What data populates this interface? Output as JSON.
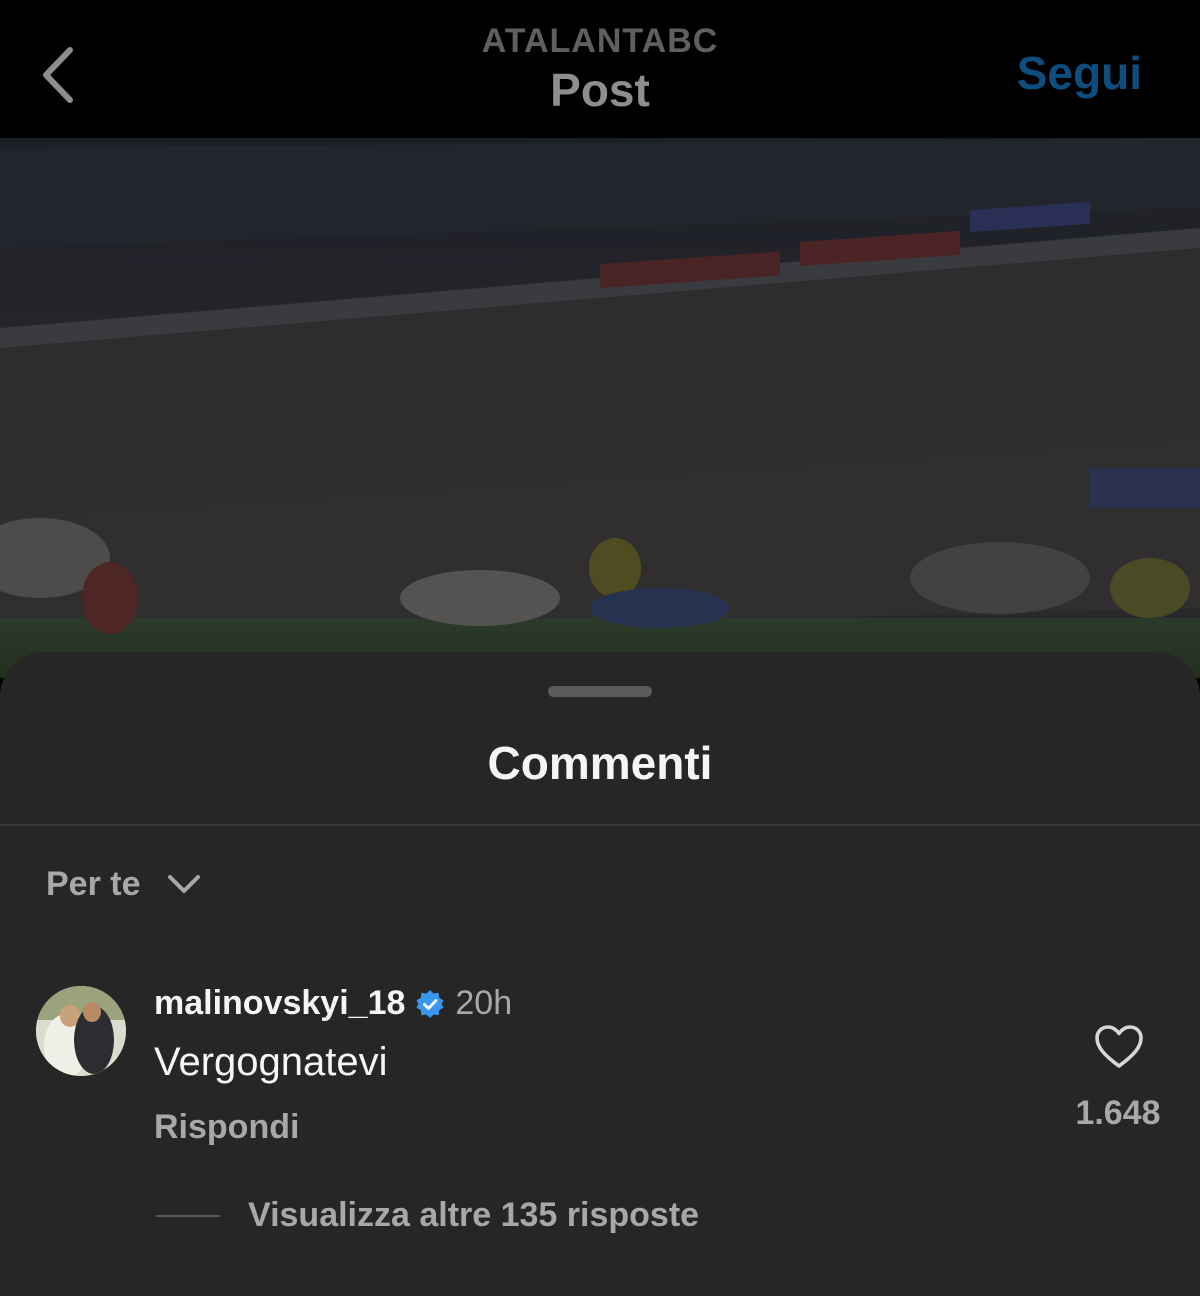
{
  "header": {
    "account": "ATALANTABC",
    "title": "Post",
    "follow_label": "Segui"
  },
  "icons": {
    "back": "chevron-left-icon",
    "sort": "chevron-down-icon",
    "verified": "verified-badge-icon",
    "like": "heart-icon"
  },
  "sheet": {
    "title": "Commenti",
    "sort_label": "Per te"
  },
  "comments": [
    {
      "username": "malinovskyi_18",
      "verified": true,
      "time": "20h",
      "text": "Vergognatevi",
      "reply_label": "Rispondi",
      "likes": "1.648",
      "view_replies_label": "Visualizza altre 135 risposte"
    }
  ],
  "colors": {
    "background": "#000000",
    "sheet": "#262626",
    "follow": "#0e4e7e",
    "verified": "#3897f0",
    "muted_text": "#a8a8a8"
  }
}
